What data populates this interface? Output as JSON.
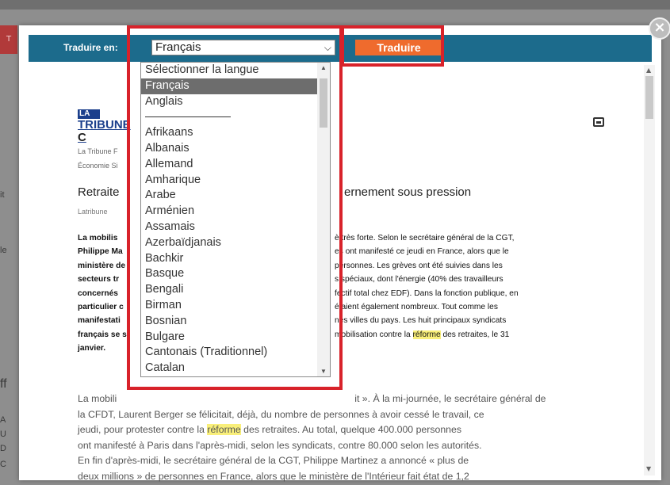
{
  "background": {
    "red_tab": "T",
    "left_chars": [
      "it",
      "le",
      "ff",
      "A",
      "U",
      "D",
      "C"
    ]
  },
  "modal": {
    "close_glyph": "×",
    "toolbar": {
      "label": "Traduire en:",
      "selected_language": "Français",
      "translate_button": "Traduire"
    },
    "dropdown": {
      "options": [
        "Sélectionner la langue",
        "Français",
        "Anglais",
        "---",
        "Afrikaans",
        "Albanais",
        "Allemand",
        "Amharique",
        "Arabe",
        "Arménien",
        "Assamais",
        "Azerbaïdjanais",
        "Bachkir",
        "Basque",
        "Bengali",
        "Birman",
        "Bosnian",
        "Bulgare",
        "Cantonais (Traditionnel)",
        "Catalan"
      ],
      "selected_index": 1
    },
    "article": {
      "logo_top": "LA",
      "logo_bottom": "TRIBUNE",
      "logo_trail": "C",
      "source_name": "La Tribune F",
      "source_category": "Économie Si",
      "headline_left": "Retraite",
      "headline_right": "ernement sous pression",
      "byline": "Latribune",
      "lead_rows": [
        {
          "l": "La mobilis",
          "r": "è très forte. Selon le secrétaire général de la CGT,"
        },
        {
          "l": "Philippe Ma",
          "r": "es ont manifesté ce jeudi en France, alors que le"
        },
        {
          "l": "ministère de",
          "r": "personnes. Les grèves ont été suivies dans les"
        },
        {
          "l": "secteurs tr",
          "r": "s spéciaux, dont l'énergie (40% des travailleurs"
        },
        {
          "l": "concernés",
          "r": "fectif total chez EDF). Dans la fonction publique, en"
        },
        {
          "l": "particulier c",
          "r": "étaient également nombreux. Tout comme les"
        },
        {
          "l": "manifestati",
          "r": "nes villes du pays. Les huit principaux syndicats"
        },
        {
          "l": "français se s",
          "r": "mobilisation contre la ",
          "hl": "réforme",
          "tail": " des retraites, le 31"
        },
        {
          "l": "janvier.",
          "r": ""
        }
      ],
      "body_rows": [
        {
          "a": "La mobili",
          "hl": "",
          "b": "it ». À la mi-journée, le secrétaire général de"
        },
        {
          "a": "la CFDT, Laurent Berger se félicitait, déjà, du nombre de personnes à avoir cessé le travail, ce",
          "hl": "",
          "b": ""
        },
        {
          "a": "jeudi, pour protester contre la ",
          "hl": "réforme",
          "b": " des retraites. Au total, quelque 400.000 personnes"
        },
        {
          "a": "ont manifesté à Paris dans l'après-midi, selon les syndicats, contre 80.000 selon les autorités.",
          "hl": "",
          "b": ""
        },
        {
          "a": "En fin d'après-midi, le secrétaire général de la CGT, Philippe Martinez a annoncé « plus de",
          "hl": "",
          "b": ""
        },
        {
          "a": "deux millions » de personnes en France, alors que le ministère de l'Intérieur fait état de 1,2",
          "hl": "",
          "b": ""
        }
      ]
    }
  },
  "colors": {
    "toolbar_bg": "#1c6b8c",
    "translate_btn": "#ef6b2d",
    "highlight_box": "#d8222a",
    "text_highlight": "#f9ef7a"
  }
}
